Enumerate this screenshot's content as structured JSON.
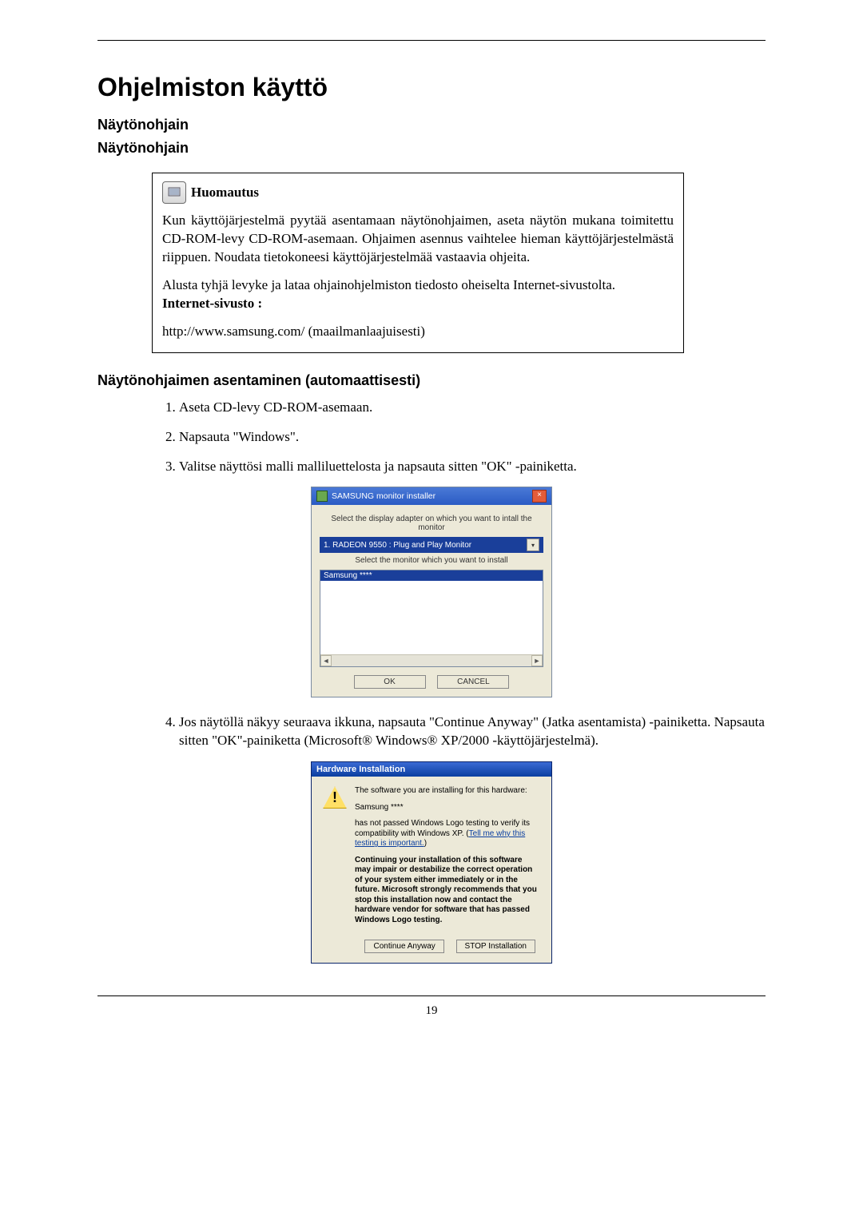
{
  "title": "Ohjelmiston käyttö",
  "subTitle1": "Näytönohjain",
  "subTitle2": "Näytönohjain",
  "note": {
    "label": "Huomautus",
    "p1": "Kun käyttöjärjestelmä pyytää asentamaan näytönohjaimen, aseta näytön mukana toimitettu CD-ROM-levy CD-ROM-asemaan. Ohjaimen asennus vaihtelee hieman käyttöjärjestelmästä riippuen. Noudata tietokoneesi käyttöjärjestelmää vastaavia ohjeita.",
    "p2a": "Alusta tyhjä levyke ja lataa ohjainohjelmiston tiedosto oheiselta Internet-sivustolta.",
    "p2b": "Internet-sivusto :",
    "p3": "http://www.samsung.com/ (maailmanlaajuisesti)"
  },
  "sectionTitle": "Näytönohjaimen asentaminen (automaattisesti)",
  "steps": {
    "s1": "Aseta CD-levy CD-ROM-asemaan.",
    "s2": "Napsauta \"Windows\".",
    "s3": "Valitse näyttösi malli malliluettelosta ja napsauta sitten \"OK\" -painiketta.",
    "s4": "Jos näytöllä näkyy seuraava ikkuna, napsauta \"Continue Anyway\" (Jatka asentamista) -painiketta. Napsauta sitten \"OK\"-painiketta (Microsoft® Windows® XP/2000 -käyttöjärjestelmä)."
  },
  "installer": {
    "title": "SAMSUNG monitor installer",
    "label1": "Select the display adapter on which you want to intall the monitor",
    "adapter": "1. RADEON 9550 : Plug and Play Monitor",
    "label2": "Select the monitor which you want to install",
    "selected": "Samsung ****",
    "ok": "OK",
    "cancel": "CANCEL"
  },
  "hwi": {
    "title": "Hardware Installation",
    "line1": "The software you are installing for this hardware:",
    "device": "Samsung ****",
    "line2a": "has not passed Windows Logo testing to verify its compatibility with Windows XP. (",
    "link": "Tell me why this testing is important.",
    "line2b": ")",
    "bold": "Continuing your installation of this software may impair or destabilize the correct operation of your system either immediately or in the future. Microsoft strongly recommends that you stop this installation now and contact the hardware vendor for software that has passed Windows Logo testing.",
    "btnContinue": "Continue Anyway",
    "btnStop": "STOP Installation"
  },
  "pageNumber": "19"
}
